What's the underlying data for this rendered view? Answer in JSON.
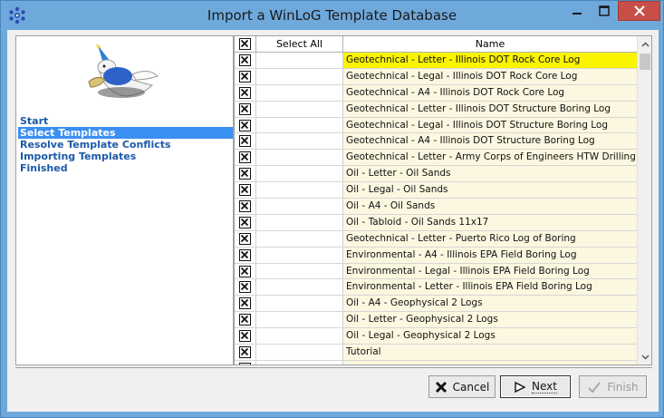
{
  "window": {
    "title": "Import a WinLoG Template Database"
  },
  "steps": [
    {
      "label": "Start",
      "active": false
    },
    {
      "label": "Select Templates",
      "active": true
    },
    {
      "label": "Resolve Template Conflicts",
      "active": false
    },
    {
      "label": "Importing Templates",
      "active": false
    },
    {
      "label": "Finished",
      "active": false
    }
  ],
  "grid": {
    "headers": {
      "select_all": "Select All",
      "name": "Name"
    },
    "rows": [
      {
        "name": "Geotechnical - Letter - Illinois DOT Rock Core Log",
        "checked": true,
        "selected": true
      },
      {
        "name": "Geotechnical - Legal - Illinois DOT Rock Core Log",
        "checked": true
      },
      {
        "name": "Geotechnical - A4 - Illinois DOT Rock Core Log",
        "checked": true
      },
      {
        "name": "Geotechnical - Letter - Illinois DOT Structure Boring Log",
        "checked": true
      },
      {
        "name": "Geotechnical - Legal - Illinois DOT Structure Boring Log",
        "checked": true
      },
      {
        "name": "Geotechnical - A4 - Illinois DOT Structure Boring Log",
        "checked": true
      },
      {
        "name": "Geotechnical - Letter - Army Corps of Engineers HTW Drilling Log",
        "checked": true
      },
      {
        "name": "Oil - Letter - Oil Sands",
        "checked": true
      },
      {
        "name": "Oil - Legal - Oil Sands",
        "checked": true
      },
      {
        "name": "Oil - A4 - Oil Sands",
        "checked": true
      },
      {
        "name": "Oil - Tabloid - Oil Sands 11x17",
        "checked": true
      },
      {
        "name": "Geotechnical - Letter - Puerto Rico Log of Boring",
        "checked": true
      },
      {
        "name": "Environmental - A4 - Illinois EPA Field Boring Log",
        "checked": true
      },
      {
        "name": "Environmental - Legal - Illinois EPA Field Boring Log",
        "checked": true
      },
      {
        "name": "Environmental - Letter - Illinois EPA Field Boring Log",
        "checked": true
      },
      {
        "name": "Oil - A4 - Geophysical 2 Logs",
        "checked": true
      },
      {
        "name": "Oil - Letter - Geophysical 2 Logs",
        "checked": true
      },
      {
        "name": "Oil - Legal - Geophysical 2 Logs",
        "checked": true
      },
      {
        "name": "Tutorial",
        "checked": true
      },
      {
        "name": "",
        "checked": true
      }
    ]
  },
  "buttons": {
    "cancel": "Cancel",
    "next": "Next",
    "finish": "Finish"
  },
  "colors": {
    "titlebar": "#6fa9dc",
    "close": "#c74f48",
    "selected_row": "#fbf400",
    "name_cell": "#fcf7e0",
    "step_active": "#3a8ff2",
    "step_text": "#1b5aa8"
  }
}
